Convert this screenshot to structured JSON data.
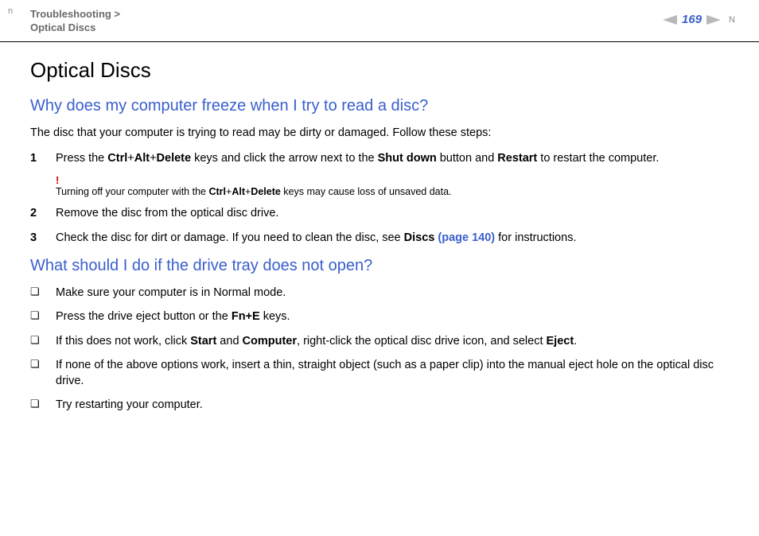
{
  "header": {
    "n_marker": "n",
    "breadcrumb_line1": "Troubleshooting >",
    "breadcrumb_line2": "Optical Discs",
    "page_number": "169",
    "N_marker": "N"
  },
  "main_title": "Optical Discs",
  "section1": {
    "title": "Why does my computer freeze when I try to read a disc?",
    "intro": "The disc that your computer is trying to read may be dirty or damaged. Follow these steps:",
    "items": [
      {
        "num": "1",
        "prefix": "Press the ",
        "bold1": "Ctrl",
        "plus1": "+",
        "bold2": "Alt",
        "plus2": "+",
        "bold3": "Delete",
        "mid1": " keys and click the arrow next to the ",
        "bold4": "Shut down",
        "mid2": " button and ",
        "bold5": "Restart",
        "suffix": " to restart the computer."
      },
      {
        "num": "2",
        "text": "Remove the disc from the optical disc drive."
      },
      {
        "num": "3",
        "prefix": "Check the disc for dirt or damage. If you need to clean the disc, see ",
        "bold1": "Discs ",
        "link": "(page 140)",
        "suffix": " for instructions."
      }
    ],
    "warning": {
      "mark": "!",
      "prefix": "Turning off your computer with the ",
      "bold1": "Ctrl",
      "plus1": "+",
      "bold2": "Alt",
      "plus2": "+",
      "bold3": "Delete",
      "suffix": " keys may cause loss of unsaved data."
    }
  },
  "section2": {
    "title": "What should I do if the drive tray does not open?",
    "items": [
      {
        "text": "Make sure your computer is in Normal mode."
      },
      {
        "prefix": "Press the drive eject button or the ",
        "bold1": "Fn+E",
        "suffix": " keys."
      },
      {
        "prefix": "If this does not work, click ",
        "bold1": "Start",
        "mid1": " and ",
        "bold2": "Computer",
        "mid2": ", right-click the optical disc drive icon, and select ",
        "bold3": "Eject",
        "suffix": "."
      },
      {
        "text": "If none of the above options work, insert a thin, straight object (such as a paper clip) into the manual eject hole on the optical disc drive."
      },
      {
        "text": "Try restarting your computer."
      }
    ]
  },
  "bullet": "❏"
}
